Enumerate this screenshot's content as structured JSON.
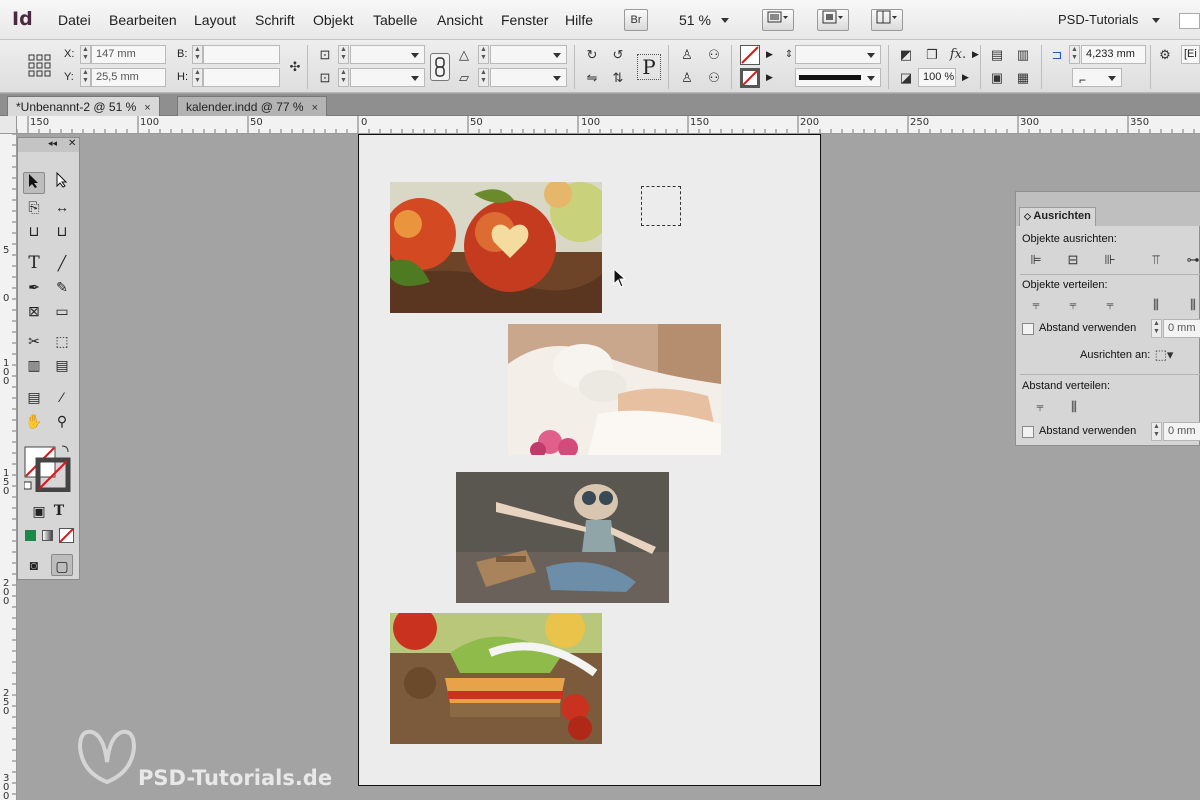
{
  "app": {
    "logo": "Id"
  },
  "menubar": {
    "items": [
      "Datei",
      "Bearbeiten",
      "Layout",
      "Schrift",
      "Objekt",
      "Tabelle",
      "Ansicht",
      "Fenster",
      "Hilfe"
    ],
    "bridge_label": "Br",
    "zoom": "51 %",
    "workspace": "PSD-Tutorials"
  },
  "control": {
    "x_label": "X:",
    "x_value": "147 mm",
    "y_label": "Y:",
    "y_value": "25,5 mm",
    "w_label": "B:",
    "w_value": "",
    "h_label": "H:",
    "h_value": "",
    "opacity": "100 %",
    "stroke_offset": "4,233 mm",
    "truncated_field": "[Ei"
  },
  "tabs": [
    {
      "label": "*Unbenannt-2 @ 51 %",
      "close": "×",
      "active": true
    },
    {
      "label": "kalender.indd @ 77 %",
      "close": "×",
      "active": false
    }
  ],
  "ruler": {
    "h_labels": [
      "150",
      "100",
      "50",
      "0",
      "50",
      "100",
      "150",
      "200",
      "250",
      "300",
      "350"
    ],
    "v_labels": [
      "5",
      "0",
      "1 0 0",
      "1 5 0",
      "2 0 0",
      "2 5 0",
      "3 0 0"
    ]
  },
  "images": [
    {
      "name": "apples-photo",
      "palette": [
        "#7a4a2a",
        "#c43b20",
        "#e8a347",
        "#c9d27a"
      ]
    },
    {
      "name": "spa-facial-photo",
      "palette": [
        "#c9a78c",
        "#f4eee8",
        "#e7c0a2",
        "#e05f8b"
      ]
    },
    {
      "name": "boy-pilot-photo",
      "palette": [
        "#5a5650",
        "#8fa5a8",
        "#6c8ea8",
        "#a8835c"
      ]
    },
    {
      "name": "vegetables-sandwich-photo",
      "palette": [
        "#7c5a3c",
        "#c8321f",
        "#8fbb4a",
        "#e9c34a"
      ]
    }
  ],
  "align_panel": {
    "title": "Ausrichten",
    "objects_align": "Objekte ausrichten:",
    "objects_distribute": "Objekte verteilen:",
    "use_spacing": "Abstand verwenden",
    "spacing_value": "0 mm",
    "align_to": "Ausrichten an:",
    "distribute_spacing": "Abstand verteilen:",
    "use_spacing_2": "Abstand verwenden",
    "spacing_value_2": "0 mm"
  },
  "watermark": {
    "text": "PSD-Tutorials.de"
  },
  "colors": {
    "page": "#ececec",
    "pasteboard": "#a3a3a3",
    "fill_swatch": "#1a8a4a",
    "none_red": "#d81818"
  }
}
